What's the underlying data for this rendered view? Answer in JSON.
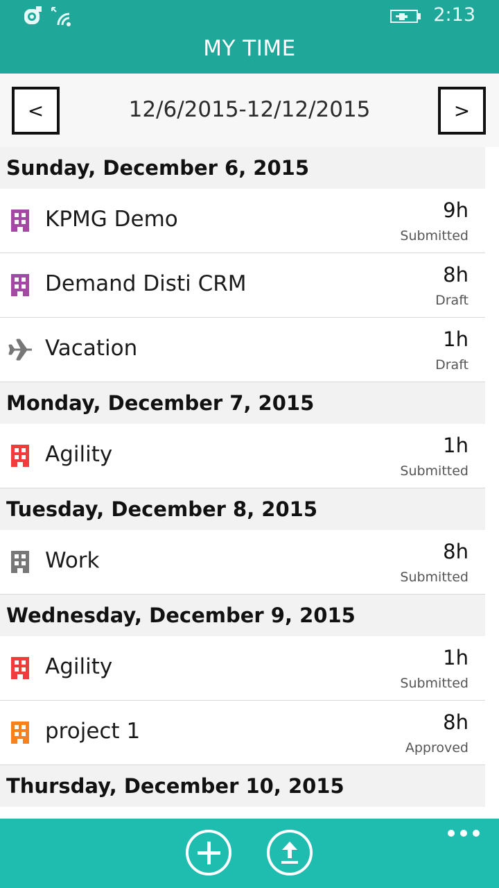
{
  "status_bar": {
    "time": "2:13",
    "icons": [
      "quiet-hours-icon",
      "wifi-icon",
      "battery-charging-icon"
    ]
  },
  "header": {
    "title": "MY TIME"
  },
  "week": {
    "prev_label": "<",
    "next_label": ">",
    "range": "12/6/2015-12/12/2015"
  },
  "colors": {
    "brand": "#1fa89a",
    "app_bar": "#1fbcb0",
    "purple": "#a349a4",
    "red": "#f03c3c",
    "gray": "#777777",
    "orange": "#f5821f"
  },
  "days": [
    {
      "label": "Sunday, December 6, 2015",
      "entries": [
        {
          "icon": "building-icon",
          "color": "#a349a4",
          "name": "KPMG Demo",
          "hours": "9h",
          "status": "Submitted"
        },
        {
          "icon": "building-icon",
          "color": "#a349a4",
          "name": "Demand Disti CRM",
          "hours": "8h",
          "status": "Draft"
        },
        {
          "icon": "airplane-icon",
          "color": "#777777",
          "name": "Vacation",
          "hours": "1h",
          "status": "Draft"
        }
      ]
    },
    {
      "label": "Monday, December 7, 2015",
      "entries": [
        {
          "icon": "building-icon",
          "color": "#f03c3c",
          "name": "Agility",
          "hours": "1h",
          "status": "Submitted"
        }
      ]
    },
    {
      "label": "Tuesday, December 8, 2015",
      "entries": [
        {
          "icon": "building-icon",
          "color": "#777777",
          "name": "Work",
          "hours": "8h",
          "status": "Submitted"
        }
      ]
    },
    {
      "label": "Wednesday, December 9, 2015",
      "entries": [
        {
          "icon": "building-icon",
          "color": "#f03c3c",
          "name": "Agility",
          "hours": "1h",
          "status": "Submitted"
        },
        {
          "icon": "building-icon",
          "color": "#f5821f",
          "name": "project 1",
          "hours": "8h",
          "status": "Approved"
        }
      ]
    },
    {
      "label": "Thursday, December 10, 2015",
      "entries": []
    }
  ],
  "app_bar": {
    "buttons": [
      "add-icon",
      "upload-icon",
      "more-icon"
    ]
  }
}
